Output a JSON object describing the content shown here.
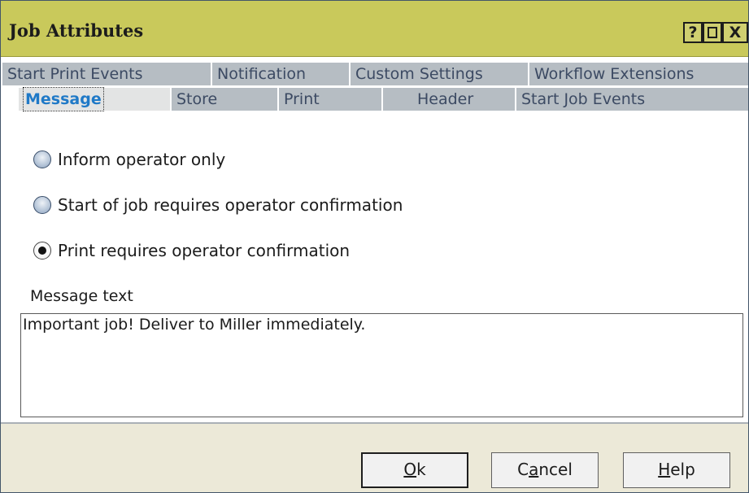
{
  "window": {
    "title": "Job Attributes",
    "help_glyph": "?",
    "close_glyph": "X"
  },
  "tabs": {
    "row1": [
      {
        "label": "Start Print Events"
      },
      {
        "label": "Notification"
      },
      {
        "label": "Custom Settings"
      },
      {
        "label": "Workflow Extensions"
      }
    ],
    "row2": [
      {
        "label": "Message",
        "active": true
      },
      {
        "label": "Store"
      },
      {
        "label": "Print"
      },
      {
        "label": "Header"
      },
      {
        "label": "Start Job Events"
      }
    ]
  },
  "options": [
    {
      "label": "Inform operator only",
      "selected": false
    },
    {
      "label": "Start of job requires operator confirmation",
      "selected": false
    },
    {
      "label": "Print requires operator confirmation",
      "selected": true
    }
  ],
  "message": {
    "label": "Message text",
    "value": "Important job! Deliver to Miller immediately."
  },
  "buttons": {
    "ok": {
      "pre": "",
      "mnemonic": "O",
      "post": "k"
    },
    "cancel": {
      "pre": "C",
      "mnemonic": "a",
      "post": "ncel"
    },
    "help": {
      "pre": "",
      "mnemonic": "H",
      "post": "elp"
    }
  },
  "colors": {
    "titlebar": "#c9c95b",
    "tab_inactive": "#b6bdc3",
    "tab_active_text": "#1f79c7",
    "footer": "#ece9d8"
  }
}
